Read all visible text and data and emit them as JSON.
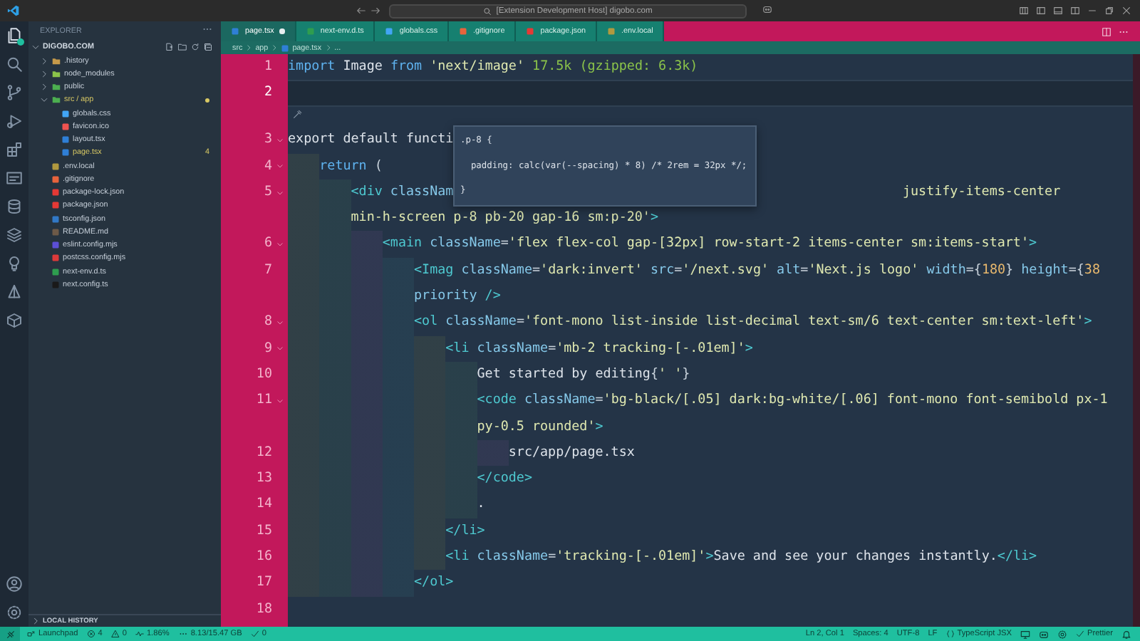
{
  "window": {
    "title": "[Extension Development Host] digobo.com"
  },
  "explorer": {
    "title": "EXPLORER",
    "section": "DIGOBO.COM",
    "items": [
      {
        "name": ".history",
        "kind": "folder",
        "expanded": false,
        "modified": false,
        "color": "#c79a4a"
      },
      {
        "name": "node_modules",
        "kind": "folder",
        "expanded": false,
        "modified": false,
        "color": "#8bc34a"
      },
      {
        "name": "public",
        "kind": "folder",
        "expanded": false,
        "modified": false,
        "color": "#4caf50"
      },
      {
        "name": "src / app",
        "kind": "folder",
        "expanded": true,
        "modified": true,
        "color": "#4caf50",
        "children": [
          {
            "name": "globals.css",
            "kind": "file",
            "modified": false,
            "color": "#42a5f5"
          },
          {
            "name": "favicon.ico",
            "kind": "file",
            "modified": false,
            "color": "#ef5350"
          },
          {
            "name": "layout.tsx",
            "kind": "file",
            "modified": false,
            "color": "#2f7fd6"
          },
          {
            "name": "page.tsx",
            "kind": "file",
            "modified": true,
            "badge": "4",
            "color": "#2f7fd6"
          }
        ]
      },
      {
        "name": ".env.local",
        "kind": "file",
        "modified": false,
        "color": "#b0993f"
      },
      {
        "name": ".gitignore",
        "kind": "file",
        "modified": false,
        "color": "#e8643c"
      },
      {
        "name": "package-lock.json",
        "kind": "file",
        "modified": false,
        "color": "#e53935"
      },
      {
        "name": "package.json",
        "kind": "file",
        "modified": false,
        "color": "#e53935"
      },
      {
        "name": "tsconfig.json",
        "kind": "file",
        "modified": false,
        "color": "#3178c6"
      },
      {
        "name": "README.md",
        "kind": "file",
        "modified": false,
        "color": "#6d5a48"
      },
      {
        "name": "eslint.config.mjs",
        "kind": "file",
        "modified": false,
        "color": "#5c4fd6"
      },
      {
        "name": "postcss.config.mjs",
        "kind": "file",
        "modified": false,
        "color": "#dd3a3a"
      },
      {
        "name": "next-env.d.ts",
        "kind": "file",
        "modified": false,
        "color": "#2e9d4f"
      },
      {
        "name": "next.config.ts",
        "kind": "file",
        "modified": false,
        "color": "#1a1a1a"
      }
    ],
    "footer": "LOCAL HISTORY"
  },
  "tabs": [
    {
      "label": "page.tsx",
      "selected": true,
      "modified": true,
      "color": "#2f7fd6"
    },
    {
      "label": "next-env.d.ts",
      "selected": false,
      "modified": false,
      "color": "#2e9d4f"
    },
    {
      "label": "globals.css",
      "selected": false,
      "modified": false,
      "color": "#42a5f5"
    },
    {
      "label": ".gitignore",
      "selected": false,
      "modified": false,
      "color": "#e8643c"
    },
    {
      "label": "package.json",
      "selected": false,
      "modified": false,
      "color": "#e53935"
    },
    {
      "label": ".env.local",
      "selected": false,
      "modified": false,
      "color": "#b0993f"
    }
  ],
  "breadcrumb": [
    {
      "label": "src",
      "kind": "folder"
    },
    {
      "label": "app",
      "kind": "folder"
    },
    {
      "label": "page.tsx",
      "kind": "file",
      "color": "#2f7fd6"
    },
    {
      "label": "...",
      "kind": "more"
    }
  ],
  "editor": {
    "lines": [
      {
        "kind": "code",
        "number": "1",
        "current": false,
        "foldable": false,
        "tokens": [
          {
            "text": "import",
            "kind": "kw"
          },
          {
            "text": " Image ",
            "kind": "plain"
          },
          {
            "text": "from",
            "kind": "kw"
          },
          {
            "text": " 'next/image'",
            "kind": "str"
          },
          {
            "text": " 17.5k (gzipped: 6.3k)",
            "kind": "cost"
          }
        ]
      },
      {
        "kind": "code",
        "number": "2",
        "current": true,
        "foldable": false
      },
      {
        "kind": "hint"
      },
      {
        "kind": "code",
        "number": "3",
        "current": false,
        "foldable": true,
        "tokens": [
          {
            "text": "export default functi",
            "kind": "plain"
          }
        ]
      },
      {
        "kind": "code",
        "number": "4",
        "current": false,
        "foldable": true,
        "tokens": [
          {
            "text": "    return",
            "kind": "kw"
          },
          {
            "text": " (",
            "kind": "punct"
          }
        ]
      },
      {
        "kind": "code",
        "number": "5",
        "current": false,
        "foldable": true,
        "tokens": [
          {
            "text": "        <div",
            "kind": "tag"
          },
          {
            "text": " classNam",
            "kind": "attr"
          },
          {
            "text": "justify-items-center",
            "kind": "str",
            "covered_before": true
          }
        ],
        "wrap": [
          {
            "text": "min-h-screen p-8 pb-20 gap-16 sm:p-20'",
            "kind": "str"
          },
          {
            "text": ">",
            "kind": "tag"
          }
        ]
      },
      {
        "kind": "code",
        "number": "6",
        "current": false,
        "foldable": true,
        "tokens": [
          {
            "text": "            <main",
            "kind": "tag"
          },
          {
            "text": " className",
            "kind": "attr"
          },
          {
            "text": "=",
            "kind": "punct"
          },
          {
            "text": "'flex flex-col gap-[32px] row-start-2 items-center sm:items-start'",
            "kind": "str"
          },
          {
            "text": ">",
            "kind": "tag"
          }
        ]
      },
      {
        "kind": "code",
        "number": "7",
        "current": false,
        "foldable": false,
        "tokens": [
          {
            "text": "                <Imag",
            "kind": "tag"
          },
          {
            "text": " className",
            "kind": "attr"
          },
          {
            "text": "=",
            "kind": "punct"
          },
          {
            "text": "'dark:invert'",
            "kind": "str"
          },
          {
            "text": " src",
            "kind": "attr"
          },
          {
            "text": "=",
            "kind": "punct"
          },
          {
            "text": "'/next.svg'",
            "kind": "str"
          },
          {
            "text": " alt",
            "kind": "attr"
          },
          {
            "text": "=",
            "kind": "punct"
          },
          {
            "text": "'Next.js logo'",
            "kind": "str"
          },
          {
            "text": " width",
            "kind": "attr"
          },
          {
            "text": "={",
            "kind": "punct"
          },
          {
            "text": "180",
            "kind": "num"
          },
          {
            "text": "}",
            "kind": "punct"
          },
          {
            "text": " height",
            "kind": "attr"
          },
          {
            "text": "={",
            "kind": "punct"
          },
          {
            "text": "38",
            "kind": "num"
          }
        ],
        "wrap": [
          {
            "text": "priority",
            "kind": "attr"
          },
          {
            "text": " />",
            "kind": "tag"
          }
        ]
      },
      {
        "kind": "code",
        "number": "8",
        "current": false,
        "foldable": true,
        "tokens": [
          {
            "text": "                <ol",
            "kind": "tag"
          },
          {
            "text": " className",
            "kind": "attr"
          },
          {
            "text": "=",
            "kind": "punct"
          },
          {
            "text": "'font-mono list-inside list-decimal text-sm/6 text-center sm:text-left'",
            "kind": "str"
          },
          {
            "text": ">",
            "kind": "tag"
          }
        ]
      },
      {
        "kind": "code",
        "number": "9",
        "current": false,
        "foldable": true,
        "tokens": [
          {
            "text": "                    <li",
            "kind": "tag"
          },
          {
            "text": " className",
            "kind": "attr"
          },
          {
            "text": "=",
            "kind": "punct"
          },
          {
            "text": "'mb-2 tracking-[-.01em]'",
            "kind": "str"
          },
          {
            "text": ">",
            "kind": "tag"
          }
        ]
      },
      {
        "kind": "code",
        "number": "10",
        "current": false,
        "foldable": false,
        "tokens": [
          {
            "text": "                        Get started by editing",
            "kind": "plain"
          },
          {
            "text": "{",
            "kind": "punct"
          },
          {
            "text": "' '",
            "kind": "str"
          },
          {
            "text": "}",
            "kind": "punct"
          }
        ]
      },
      {
        "kind": "code",
        "number": "11",
        "current": false,
        "foldable": true,
        "tokens": [
          {
            "text": "                        <code",
            "kind": "tag"
          },
          {
            "text": " className",
            "kind": "attr"
          },
          {
            "text": "=",
            "kind": "punct"
          },
          {
            "text": "'bg-black/[.05] dark:bg-white/[.06] font-mono font-semibold px-1",
            "kind": "str"
          }
        ],
        "wrap": [
          {
            "text": "py-0.5 rounded'",
            "kind": "str"
          },
          {
            "text": ">",
            "kind": "tag"
          }
        ]
      },
      {
        "kind": "code",
        "number": "12",
        "current": false,
        "foldable": false,
        "tokens": [
          {
            "text": "                            src/app/page.tsx",
            "kind": "plain"
          }
        ]
      },
      {
        "kind": "code",
        "number": "13",
        "current": false,
        "foldable": false,
        "tokens": [
          {
            "text": "                        </code>",
            "kind": "tag"
          }
        ]
      },
      {
        "kind": "code",
        "number": "14",
        "current": false,
        "foldable": false,
        "tokens": [
          {
            "text": "                        .",
            "kind": "plain"
          }
        ]
      },
      {
        "kind": "code",
        "number": "15",
        "current": false,
        "foldable": false,
        "tokens": [
          {
            "text": "                    </li>",
            "kind": "tag"
          }
        ]
      },
      {
        "kind": "code",
        "number": "16",
        "current": false,
        "foldable": false,
        "tokens": [
          {
            "text": "                    <li",
            "kind": "tag"
          },
          {
            "text": " className",
            "kind": "attr"
          },
          {
            "text": "=",
            "kind": "punct"
          },
          {
            "text": "'tracking-[-.01em]'",
            "kind": "str"
          },
          {
            "text": ">",
            "kind": "tag"
          },
          {
            "text": "Save and see your changes instantly.",
            "kind": "plain"
          },
          {
            "text": "</li>",
            "kind": "tag"
          }
        ]
      },
      {
        "kind": "code",
        "number": "17",
        "current": false,
        "foldable": false,
        "tokens": [
          {
            "text": "                </ol>",
            "kind": "tag"
          }
        ]
      },
      {
        "kind": "code",
        "number": "18",
        "current": false,
        "foldable": false
      }
    ],
    "hover": {
      "lines": [
        ".p-8 {",
        "  padding: calc(var(--spacing) * 8) /* 2rem = 32px */;",
        "}"
      ]
    }
  },
  "status_bar": {
    "left": [
      {
        "kind": "launchpad",
        "text": "Launchpad"
      },
      {
        "kind": "errors",
        "text": "4"
      },
      {
        "kind": "warnings",
        "text": "0"
      },
      {
        "kind": "cpu",
        "text": "1.86%"
      },
      {
        "kind": "memory",
        "text": "8.13/15.47 GB"
      },
      {
        "kind": "check",
        "text": "0"
      }
    ],
    "right": [
      {
        "kind": "text",
        "text": "Ln 2, Col 1"
      },
      {
        "kind": "text",
        "text": "Spaces: 4"
      },
      {
        "kind": "text",
        "text": "UTF-8"
      },
      {
        "kind": "text",
        "text": "LF"
      },
      {
        "kind": "language",
        "text": "TypeScript JSX"
      },
      {
        "kind": "screen"
      },
      {
        "kind": "copilot"
      },
      {
        "kind": "extension"
      },
      {
        "kind": "prettier",
        "text": "Prettier"
      },
      {
        "kind": "bell"
      }
    ]
  }
}
